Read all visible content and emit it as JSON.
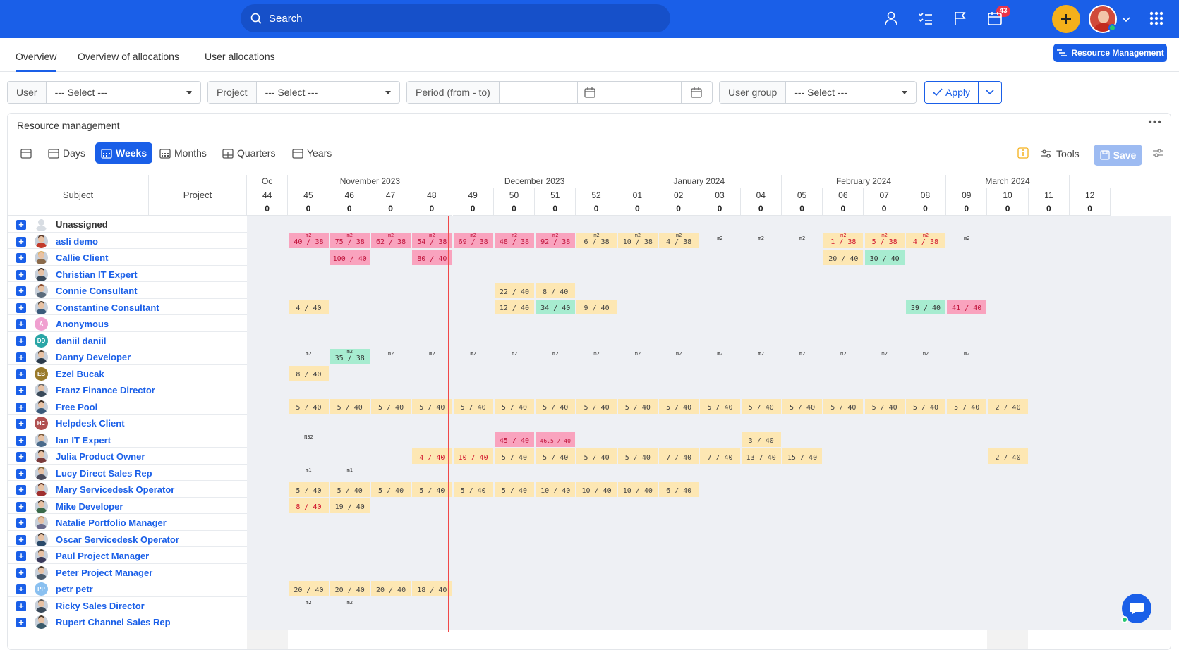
{
  "topbar": {
    "search_placeholder": "Search",
    "notification_count": "43",
    "icons": [
      "user-icon",
      "tasks-icon",
      "flag-icon",
      "calendar-icon",
      "plus-icon",
      "avatar",
      "chevron-down-icon",
      "apps-grid-icon"
    ]
  },
  "tabs": [
    "Overview",
    "Overview of allocations",
    "User allocations"
  ],
  "resource_button": "Resource Management",
  "filters": {
    "user_label": "User",
    "user_value": "--- Select ---",
    "project_label": "Project",
    "project_value": "--- Select ---",
    "period_label": "Period (from - to)",
    "usergroup_label": "User group",
    "usergroup_value": "--- Select ---",
    "apply_label": "Apply"
  },
  "panel": {
    "title": "Resource management",
    "views": [
      "Days",
      "Weeks",
      "Months",
      "Quarters",
      "Years"
    ],
    "active_view": "Weeks",
    "tools_label": "Tools",
    "save_label": "Save"
  },
  "grid": {
    "subject_header": "Subject",
    "project_header": "Project",
    "months": [
      {
        "label": "Oc",
        "span": 1
      },
      {
        "label": "November 2023",
        "span": 4
      },
      {
        "label": "December 2023",
        "span": 4
      },
      {
        "label": "January 2024",
        "span": 4
      },
      {
        "label": "February 2024",
        "span": 4
      },
      {
        "label": "March 2024",
        "span": 3
      }
    ],
    "weeks": [
      "44",
      "45",
      "46",
      "47",
      "48",
      "49",
      "50",
      "51",
      "52",
      "01",
      "02",
      "03",
      "04",
      "05",
      "06",
      "07",
      "08",
      "09",
      "10",
      "11",
      "12"
    ],
    "totals": [
      "0",
      "0",
      "0",
      "0",
      "0",
      "0",
      "0",
      "0",
      "0",
      "0",
      "0",
      "0",
      "0",
      "0",
      "0",
      "0",
      "0",
      "0",
      "0",
      "0",
      "0"
    ],
    "rows": [
      {
        "name": "Unassigned",
        "cells": []
      },
      {
        "name": "asli demo",
        "cells": [
          {
            "w": 1,
            "t": "40 / 38",
            "s": "m2",
            "c": "p"
          },
          {
            "w": 2,
            "t": "75 / 38",
            "s": "m2",
            "c": "p"
          },
          {
            "w": 3,
            "t": "62 / 38",
            "s": "m2",
            "c": "p"
          },
          {
            "w": 4,
            "t": "54 / 38",
            "s": "m2",
            "c": "p"
          },
          {
            "w": 5,
            "t": "69 / 38",
            "s": "m2",
            "c": "p"
          },
          {
            "w": 6,
            "t": "48 / 38",
            "s": "m2",
            "c": "p"
          },
          {
            "w": 7,
            "t": "92 / 38",
            "s": "m2",
            "c": "p"
          },
          {
            "w": 8,
            "t": "6 / 38",
            "s": "m2",
            "c": "y"
          },
          {
            "w": 9,
            "t": "10 / 38",
            "s": "m2",
            "c": "y"
          },
          {
            "w": 10,
            "t": "4 / 38",
            "s": "m2",
            "c": "y"
          },
          {
            "w": 11,
            "t": "",
            "s": "m2",
            "c": "n"
          },
          {
            "w": 12,
            "t": "",
            "s": "m2",
            "c": "n"
          },
          {
            "w": 13,
            "t": "",
            "s": "m2",
            "c": "n"
          },
          {
            "w": 14,
            "t": "1 / 38",
            "s": "m2",
            "c": "yr"
          },
          {
            "w": 15,
            "t": "5 / 38",
            "s": "m2",
            "c": "yr"
          },
          {
            "w": 16,
            "t": "4 / 38",
            "s": "m2",
            "c": "yr"
          },
          {
            "w": 17,
            "t": "",
            "s": "m2",
            "c": "n"
          }
        ]
      },
      {
        "name": "Callie Client",
        "cells": [
          {
            "w": 2,
            "t": "100 / 40",
            "s": "",
            "c": "p"
          },
          {
            "w": 4,
            "t": "80 / 40",
            "s": "",
            "c": "p"
          },
          {
            "w": 14,
            "t": "20 / 40",
            "s": "",
            "c": "y"
          },
          {
            "w": 15,
            "t": "30 / 40",
            "s": "",
            "c": "g"
          }
        ]
      },
      {
        "name": "Christian IT Expert",
        "cells": []
      },
      {
        "name": "Connie Consultant",
        "cells": [
          {
            "w": 6,
            "t": "22 / 40",
            "s": "",
            "c": "y"
          },
          {
            "w": 7,
            "t": "8 / 40",
            "s": "",
            "c": "y"
          }
        ]
      },
      {
        "name": "Constantine Consultant",
        "cells": [
          {
            "w": 1,
            "t": "4 / 40",
            "s": "",
            "c": "y"
          },
          {
            "w": 6,
            "t": "12 / 40",
            "s": "",
            "c": "y"
          },
          {
            "w": 7,
            "t": "34 / 40",
            "s": "",
            "c": "g"
          },
          {
            "w": 8,
            "t": "9 / 40",
            "s": "",
            "c": "y"
          },
          {
            "w": 16,
            "t": "39 / 40",
            "s": "",
            "c": "g"
          },
          {
            "w": 17,
            "t": "41 / 40",
            "s": "",
            "c": "p"
          }
        ]
      },
      {
        "name": "Anonymous",
        "cells": []
      },
      {
        "name": "daniil daniil",
        "cells": []
      },
      {
        "name": "Danny Developer",
        "cells": [
          {
            "w": 1,
            "t": "",
            "s": "m2",
            "c": "n"
          },
          {
            "w": 2,
            "t": "35 / 38",
            "s": "m2",
            "c": "g"
          },
          {
            "w": 3,
            "t": "",
            "s": "m2",
            "c": "n"
          },
          {
            "w": 4,
            "t": "",
            "s": "m2",
            "c": "n"
          },
          {
            "w": 5,
            "t": "",
            "s": "m2",
            "c": "n"
          },
          {
            "w": 6,
            "t": "",
            "s": "m2",
            "c": "n"
          },
          {
            "w": 7,
            "t": "",
            "s": "m2",
            "c": "n"
          },
          {
            "w": 8,
            "t": "",
            "s": "m2",
            "c": "n"
          },
          {
            "w": 9,
            "t": "",
            "s": "m2",
            "c": "n"
          },
          {
            "w": 10,
            "t": "",
            "s": "m2",
            "c": "n"
          },
          {
            "w": 11,
            "t": "",
            "s": "m2",
            "c": "n"
          },
          {
            "w": 12,
            "t": "",
            "s": "m2",
            "c": "n"
          },
          {
            "w": 13,
            "t": "",
            "s": "m2",
            "c": "n"
          },
          {
            "w": 14,
            "t": "",
            "s": "m2",
            "c": "n"
          },
          {
            "w": 15,
            "t": "",
            "s": "m2",
            "c": "n"
          },
          {
            "w": 16,
            "t": "",
            "s": "m2",
            "c": "n"
          },
          {
            "w": 17,
            "t": "",
            "s": "m2",
            "c": "n"
          }
        ]
      },
      {
        "name": "Ezel Bucak",
        "cells": [
          {
            "w": 1,
            "t": "8 / 40",
            "s": "",
            "c": "y"
          }
        ]
      },
      {
        "name": "Franz Finance Director",
        "cells": []
      },
      {
        "name": "Free Pool",
        "cells": [
          {
            "w": 1,
            "t": "5 / 40",
            "s": "",
            "c": "y"
          },
          {
            "w": 2,
            "t": "5 / 40",
            "s": "",
            "c": "y"
          },
          {
            "w": 3,
            "t": "5 / 40",
            "s": "",
            "c": "y"
          },
          {
            "w": 4,
            "t": "5 / 40",
            "s": "",
            "c": "y"
          },
          {
            "w": 5,
            "t": "5 / 40",
            "s": "",
            "c": "y"
          },
          {
            "w": 6,
            "t": "5 / 40",
            "s": "",
            "c": "y"
          },
          {
            "w": 7,
            "t": "5 / 40",
            "s": "",
            "c": "y"
          },
          {
            "w": 8,
            "t": "5 / 40",
            "s": "",
            "c": "y"
          },
          {
            "w": 9,
            "t": "5 / 40",
            "s": "",
            "c": "y"
          },
          {
            "w": 10,
            "t": "5 / 40",
            "s": "",
            "c": "y"
          },
          {
            "w": 11,
            "t": "5 / 40",
            "s": "",
            "c": "y"
          },
          {
            "w": 12,
            "t": "5 / 40",
            "s": "",
            "c": "y"
          },
          {
            "w": 13,
            "t": "5 / 40",
            "s": "",
            "c": "y"
          },
          {
            "w": 14,
            "t": "5 / 40",
            "s": "",
            "c": "y"
          },
          {
            "w": 15,
            "t": "5 / 40",
            "s": "",
            "c": "y"
          },
          {
            "w": 16,
            "t": "5 / 40",
            "s": "",
            "c": "y"
          },
          {
            "w": 17,
            "t": "5 / 40",
            "s": "",
            "c": "y"
          },
          {
            "w": 18,
            "t": "2 / 40",
            "s": "",
            "c": "y"
          }
        ]
      },
      {
        "name": "Helpdesk Client",
        "cells": []
      },
      {
        "name": "Ian IT Expert",
        "cells": [
          {
            "w": 1,
            "t": "",
            "s": "N32",
            "c": "n"
          },
          {
            "w": 6,
            "t": "45 / 40",
            "s": "",
            "c": "p"
          },
          {
            "w": 7,
            "t": "46.5 / 40",
            "s": "",
            "c": "p"
          },
          {
            "w": 12,
            "t": "3 / 40",
            "s": "",
            "c": "y"
          }
        ]
      },
      {
        "name": "Julia Product Owner",
        "cells": [
          {
            "w": 4,
            "t": "4 / 40",
            "s": "",
            "c": "yr"
          },
          {
            "w": 5,
            "t": "10 / 40",
            "s": "",
            "c": "yr"
          },
          {
            "w": 6,
            "t": "5 / 40",
            "s": "",
            "c": "y"
          },
          {
            "w": 7,
            "t": "5 / 40",
            "s": "",
            "c": "y"
          },
          {
            "w": 8,
            "t": "5 / 40",
            "s": "",
            "c": "y"
          },
          {
            "w": 9,
            "t": "5 / 40",
            "s": "",
            "c": "y"
          },
          {
            "w": 10,
            "t": "7 / 40",
            "s": "",
            "c": "y"
          },
          {
            "w": 11,
            "t": "7 / 40",
            "s": "",
            "c": "y"
          },
          {
            "w": 12,
            "t": "13 / 40",
            "s": "",
            "c": "y"
          },
          {
            "w": 13,
            "t": "15 / 40",
            "s": "",
            "c": "y"
          },
          {
            "w": 18,
            "t": "2 / 40",
            "s": "",
            "c": "y"
          }
        ]
      },
      {
        "name": "Lucy Direct Sales Rep",
        "cells": [
          {
            "w": 1,
            "t": "",
            "s": "m1",
            "c": "n"
          },
          {
            "w": 2,
            "t": "",
            "s": "m1",
            "c": "n"
          }
        ]
      },
      {
        "name": "Mary Servicedesk Operator",
        "cells": [
          {
            "w": 1,
            "t": "5 / 40",
            "s": "",
            "c": "y"
          },
          {
            "w": 2,
            "t": "5 / 40",
            "s": "",
            "c": "y"
          },
          {
            "w": 3,
            "t": "5 / 40",
            "s": "",
            "c": "y"
          },
          {
            "w": 4,
            "t": "5 / 40",
            "s": "",
            "c": "y"
          },
          {
            "w": 5,
            "t": "5 / 40",
            "s": "",
            "c": "y"
          },
          {
            "w": 6,
            "t": "5 / 40",
            "s": "",
            "c": "y"
          },
          {
            "w": 7,
            "t": "10 / 40",
            "s": "",
            "c": "y"
          },
          {
            "w": 8,
            "t": "10 / 40",
            "s": "",
            "c": "y"
          },
          {
            "w": 9,
            "t": "10 / 40",
            "s": "",
            "c": "y"
          },
          {
            "w": 10,
            "t": "6 / 40",
            "s": "",
            "c": "y"
          }
        ]
      },
      {
        "name": "Mike Developer",
        "cells": [
          {
            "w": 1,
            "t": "8 / 40",
            "s": "",
            "c": "yr"
          },
          {
            "w": 2,
            "t": "19 / 40",
            "s": "",
            "c": "y"
          }
        ]
      },
      {
        "name": "Natalie Portfolio Manager",
        "cells": []
      },
      {
        "name": "Oscar Servicedesk Operator",
        "cells": []
      },
      {
        "name": "Paul Project Manager",
        "cells": []
      },
      {
        "name": "Peter Project Manager",
        "cells": []
      },
      {
        "name": "petr petr",
        "cells": [
          {
            "w": 1,
            "t": "20 / 40",
            "s": "",
            "c": "y"
          },
          {
            "w": 2,
            "t": "20 / 40",
            "s": "",
            "c": "y"
          },
          {
            "w": 3,
            "t": "20 / 40",
            "s": "",
            "c": "y"
          },
          {
            "w": 4,
            "t": "18 / 40",
            "s": "",
            "c": "y"
          }
        ]
      },
      {
        "name": "Ricky Sales Director",
        "cells": [
          {
            "w": 1,
            "t": "",
            "s": "m2",
            "c": "n"
          },
          {
            "w": 2,
            "t": "",
            "s": "m2",
            "c": "n"
          }
        ]
      },
      {
        "name": "Rupert Channel Sales Rep",
        "cells": []
      }
    ],
    "avatars": [
      {
        "type": "ghost"
      },
      {
        "type": "photo",
        "hair": "#5a3a2a",
        "body": "#c23a2a"
      },
      {
        "type": "photo",
        "hair": "#e0b060",
        "body": "#8a6a4a"
      },
      {
        "type": "photo",
        "hair": "#3a2a20",
        "body": "#3a4a5a"
      },
      {
        "type": "photo",
        "hair": "#8a4a2a",
        "body": "#5a6a7a"
      },
      {
        "type": "photo",
        "hair": "#4a3a2a",
        "body": "#3a5a7a"
      },
      {
        "type": "init",
        "text": "A",
        "color": "#f0a0d0"
      },
      {
        "type": "init",
        "text": "DD",
        "color": "#2aa6a6"
      },
      {
        "type": "photo",
        "hair": "#4a3a2a",
        "body": "#2a3a4a"
      },
      {
        "type": "init",
        "text": "EB",
        "color": "#9a7a2a"
      },
      {
        "type": "photo",
        "hair": "#6a6a6a",
        "body": "#3a4a5a"
      },
      {
        "type": "photo",
        "hair": "#3a2a20",
        "body": "#3a5a7a"
      },
      {
        "type": "init",
        "text": "HC",
        "color": "#b05050"
      },
      {
        "type": "photo",
        "hair": "#7a5a3a",
        "body": "#4a6a8a"
      },
      {
        "type": "photo",
        "hair": "#3a2a20",
        "body": "#7a3a3a"
      },
      {
        "type": "photo",
        "hair": "#8a6a3a",
        "body": "#4a4a5a"
      },
      {
        "type": "photo",
        "hair": "#5a2a1a",
        "body": "#a03030"
      },
      {
        "type": "photo",
        "hair": "#3a2a20",
        "body": "#3a6a4a"
      },
      {
        "type": "photo",
        "hair": "#c09060",
        "body": "#6a6a8a"
      },
      {
        "type": "photo",
        "hair": "#3a2a20",
        "body": "#2a4a6a"
      },
      {
        "type": "photo",
        "hair": "#5a4a3a",
        "body": "#3a3a5a"
      },
      {
        "type": "photo",
        "hair": "#4a3a2a",
        "body": "#4a5a6a"
      },
      {
        "type": "init",
        "text": "PP",
        "color": "#8ac0f0"
      },
      {
        "type": "photo",
        "hair": "#5a5a5a",
        "body": "#3a4a5a"
      },
      {
        "type": "photo",
        "hair": "#4a3a2a",
        "body": "#3a5a6a"
      }
    ]
  }
}
